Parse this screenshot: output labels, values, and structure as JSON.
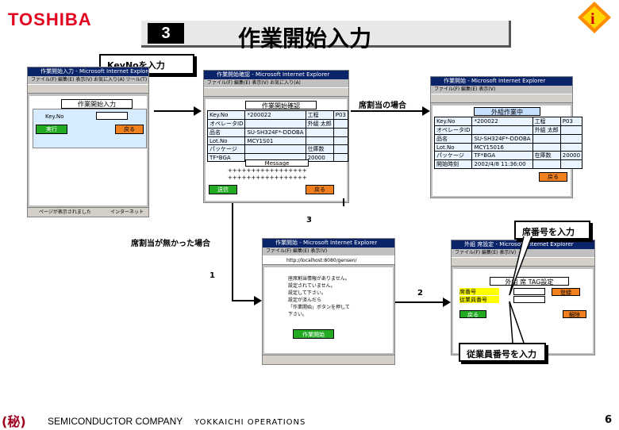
{
  "brand": "TOSHIBA",
  "slide": {
    "number": "3",
    "title": "作業開始入力"
  },
  "callouts": {
    "keyno": "KeyNoを入力",
    "seat_number": "席番号を入力",
    "employee_number": "従業員番号を入力"
  },
  "labels": {
    "seat_assigned": "席割当の場合",
    "no_seat": "席割当が無かった場合",
    "num1": "1",
    "num2": "2",
    "num3": "3"
  },
  "win1": {
    "title": "作業開始入力 - Microsoft Internet Explorer",
    "menu": "ファイル(F) 編集(E) 表示(V) お気に入り(A) ツール(T)",
    "header": "作業開始入力",
    "field_label": "Key.No",
    "run_btn": "実行",
    "back_btn": "戻る",
    "status": "ページが表示されました",
    "zone": "インターネット"
  },
  "win2": {
    "title": "作業開始確認 - Microsoft Internet Explorer",
    "menu": "ファイル(F) 編集(E) 表示(V) お気に入り(A)",
    "header": "作業開始確認",
    "rows": [
      [
        "Key.No",
        "*200022",
        "工程",
        "P03"
      ],
      [
        "オペレータID",
        "",
        "外組 太郎",
        ""
      ],
      [
        "品名",
        "SU-SH324F*-DDOBA",
        "",
        ""
      ],
      [
        "Lot.No",
        "MCY1S01",
        "",
        ""
      ],
      [
        "パッケージ",
        "",
        "仕庫数",
        ""
      ],
      [
        "TF*BGA",
        "",
        "20000",
        ""
      ]
    ],
    "message_label": "Message",
    "message_lines": [
      "+++++++++++++++++",
      "+++++++++++++++++"
    ],
    "send_btn": "送信",
    "back_btn": "戻る"
  },
  "win3": {
    "title": "作業開始 - Microsoft Internet Explorer",
    "menu": "ファイル(F) 編集(E) 表示(V)",
    "header": "外組作業中",
    "rows": [
      [
        "Key.No",
        "*200022",
        "工程",
        "P03"
      ],
      [
        "オペレータID",
        "",
        "外組 太郎",
        ""
      ],
      [
        "品名",
        "SU-SH324F*-DDOBA",
        "",
        ""
      ],
      [
        "Lot.No",
        "MCY15016",
        "",
        ""
      ],
      [
        "パッケージ",
        "TF*BGA",
        "在庫数",
        "20000"
      ],
      [
        "開始時刻",
        "2002/4/8 11:36:00",
        "",
        ""
      ]
    ],
    "back_btn": "戻る"
  },
  "win4": {
    "title": "作業開始 - Microsoft Internet Explorer",
    "menu": "ファイル(F) 編集(E) 表示(V)",
    "address": "http://localhost:8080/gensen/",
    "message_lines": [
      "座席割当情報がありません。",
      "設定されていません。",
      "設定して下さい。",
      "設定が済んだら",
      "「作業開始」ボタンを押して",
      "下さい。"
    ],
    "button": "作業開始"
  },
  "win5": {
    "title": "外組 席設定 - Microsoft Internet Explorer",
    "menu": "ファイル(F) 編集(E) 表示(V)",
    "header": "外組 席 TAG設定",
    "seat_label": "席番号",
    "emp_label": "従業員番号",
    "register_btn": "登録",
    "back_btn": "戻る",
    "delete_btn": "解除"
  },
  "footer": {
    "secret": "(秘)",
    "company": "SEMICONDUCTOR COMPANY",
    "ops": "YOKKAICHI OPERATIONS",
    "page": "6"
  }
}
